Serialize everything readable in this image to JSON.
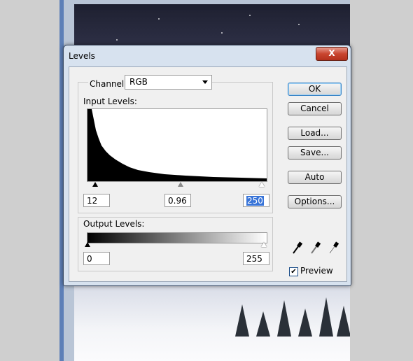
{
  "dialog": {
    "title": "Levels",
    "close_label": "X",
    "channel_label": "Channel:",
    "channel_value": "RGB",
    "input_levels_label": "Input Levels:",
    "input_black": "12",
    "input_gamma": "0.96",
    "input_white": "250",
    "output_levels_label": "Output Levels:",
    "output_black": "0",
    "output_white": "255",
    "buttons": {
      "ok": "OK",
      "cancel": "Cancel",
      "load": "Load...",
      "save": "Save...",
      "auto": "Auto",
      "options": "Options..."
    },
    "preview_label": "Preview",
    "preview_checked": true,
    "icons": [
      "black-eyedropper-icon",
      "gray-eyedropper-icon",
      "white-eyedropper-icon"
    ]
  }
}
